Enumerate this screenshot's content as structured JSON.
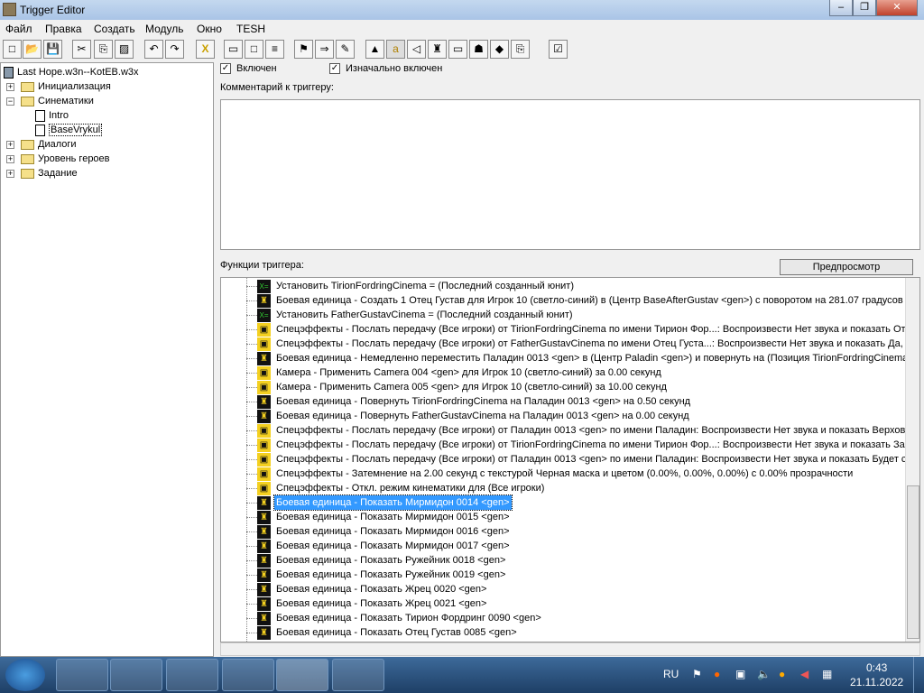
{
  "window": {
    "title": "Trigger Editor",
    "min": "–",
    "max": "❐",
    "close": "✕"
  },
  "menu": [
    "Файл",
    "Правка",
    "Создать",
    "Модуль",
    "Окно",
    "TESH"
  ],
  "toolbar": {
    "icons": [
      "new-icon",
      "open-icon",
      "save-icon",
      "cut-icon",
      "copy-icon",
      "paste-icon",
      "undo-icon",
      "redo-icon",
      "variables-icon",
      "new-category-icon",
      "new-trigger-icon",
      "new-comment-icon",
      "new-event-icon",
      "new-condition-icon",
      "new-action-icon",
      "terrain-editor-icon",
      "trigger-editor-icon",
      "sound-editor-icon",
      "object-editor-icon",
      "campaign-editor-icon",
      "ai-editor-icon",
      "import-manager-icon",
      "test-map-icon",
      "jass-check-icon"
    ]
  },
  "tree": {
    "root": "Last Hope.w3n--KotEB.w3x",
    "items": [
      {
        "label": "Инициализация",
        "type": "folder"
      },
      {
        "label": "Синематики",
        "type": "folder-open"
      },
      {
        "label": "Intro",
        "type": "trigger"
      },
      {
        "label": "BaseVrykul",
        "type": "trigger",
        "selected": true
      },
      {
        "label": "Диалоги",
        "type": "folder"
      },
      {
        "label": "Уровень героев",
        "type": "folder"
      },
      {
        "label": "Задание",
        "type": "folder"
      }
    ]
  },
  "trigger": {
    "enabled_label": "Включен",
    "enabled": true,
    "initially_on_label": "Изначально включен",
    "initially_on": true,
    "comment_label": "Комментарий к триггеру:",
    "comment": "",
    "functions_label": "Функции триггера:",
    "preview_button": "Предпросмотр"
  },
  "actions": [
    {
      "icon": "set-variable",
      "text": "Установить TirionFordringCinema = (Последний созданный юнит)"
    },
    {
      "icon": "unit",
      "text": "Боевая единица - Создать 1 Отец Густав для Игрок 10 (светло-синий) в (Центр BaseAfterGustav <gen>) с поворотом на 281.07 градусов"
    },
    {
      "icon": "set-variable",
      "text": "Установить FatherGustavCinema = (Последний созданный юнит)"
    },
    {
      "icon": "cinematic",
      "text": "Спецэффекты - Послать передачу (Все игроки) от TirionFordringCinema по имени Тирион Фор...: Воспроизвести Нет звука и показать Отли"
    },
    {
      "icon": "cinematic",
      "text": "Спецэффекты - Послать передачу (Все игроки) от FatherGustavCinema по имени Отец Густа...: Воспроизвести Нет звука и показать Да, эт"
    },
    {
      "icon": "unit",
      "text": "Боевая единица - Немедленно переместить Паладин 0013 <gen> в (Центр Paladin <gen>) и повернуть на (Позиция TirionFordringCinema)"
    },
    {
      "icon": "cinematic",
      "text": "Камера - Применить Camera 004 <gen> для Игрок 10 (светло-синий) за 0.00 секунд"
    },
    {
      "icon": "cinematic",
      "text": "Камера - Применить Camera 005 <gen> для Игрок 10 (светло-синий) за 10.00 секунд"
    },
    {
      "icon": "unit",
      "text": "Боевая единица - Повернуть TirionFordringCinema на Паладин 0013 <gen> на 0.50 секунд"
    },
    {
      "icon": "unit",
      "text": "Боевая единица - Повернуть FatherGustavCinema на Паладин 0013 <gen> на 0.00 секунд"
    },
    {
      "icon": "cinematic",
      "text": "Спецэффекты - Послать передачу (Все игроки) от Паладин 0013 <gen> по имени Паладин: Воспроизвести Нет звука и показать Верховны"
    },
    {
      "icon": "cinematic",
      "text": "Спецэффекты - Послать передачу (Все игроки) от TirionFordringCinema по имени Тирион Фор...: Воспроизвести Нет звука и показать Заме"
    },
    {
      "icon": "cinematic",
      "text": "Спецэффекты - Послать передачу (Все игроки) от Паладин 0013 <gen> по имени Паладин: Воспроизвести Нет звука и показать Будет сде"
    },
    {
      "icon": "cinematic",
      "text": "Спецэффекты - Затемнение на 2.00 секунд с текстурой Черная маска и цветом (0.00%, 0.00%, 0.00%) с 0.00% прозрачности"
    },
    {
      "icon": "cinematic",
      "text": "Спецэффекты - Откл. режим кинематики для (Все игроки)"
    },
    {
      "icon": "unit",
      "text": "Боевая единица - Показать Мирмидон 0014 <gen>",
      "selected": true
    },
    {
      "icon": "unit",
      "text": "Боевая единица - Показать Мирмидон 0015 <gen>"
    },
    {
      "icon": "unit",
      "text": "Боевая единица - Показать Мирмидон 0016 <gen>"
    },
    {
      "icon": "unit",
      "text": "Боевая единица - Показать Мирмидон 0017 <gen>"
    },
    {
      "icon": "unit",
      "text": "Боевая единица - Показать Ружейник 0018 <gen>"
    },
    {
      "icon": "unit",
      "text": "Боевая единица - Показать Ружейник 0019 <gen>"
    },
    {
      "icon": "unit",
      "text": "Боевая единица - Показать Жрец 0020 <gen>"
    },
    {
      "icon": "unit",
      "text": "Боевая единица - Показать Жрец 0021 <gen>"
    },
    {
      "icon": "unit",
      "text": "Боевая единица - Показать Тирион Фордринг 0090 <gen>"
    },
    {
      "icon": "unit",
      "text": "Боевая единица - Показать Отец Густав 0085 <gen>"
    }
  ],
  "taskbar": {
    "lang": "RU",
    "time": "0:43",
    "date": "21.11.2022"
  }
}
